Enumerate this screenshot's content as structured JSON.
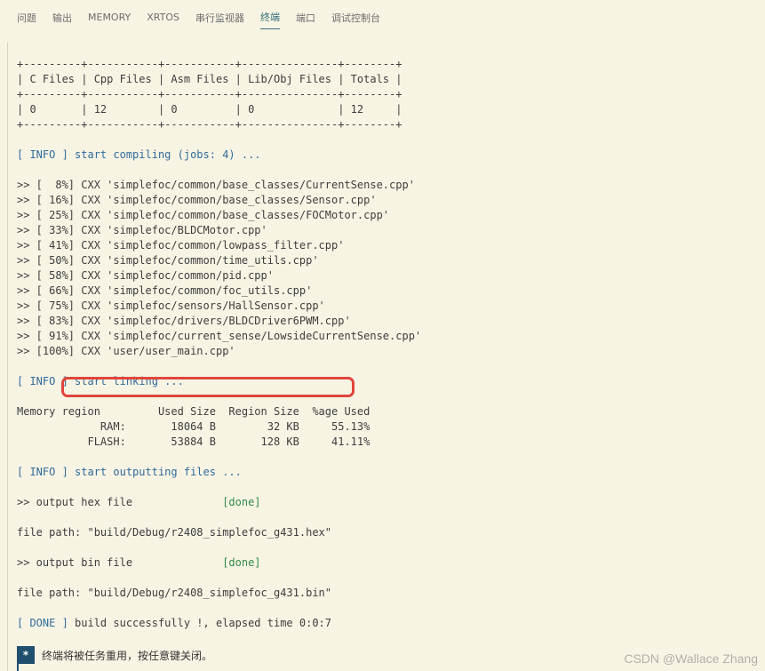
{
  "tabs": [
    {
      "label": "问题",
      "active": false
    },
    {
      "label": "输出",
      "active": false
    },
    {
      "label": "MEMORY",
      "active": false
    },
    {
      "label": "XRTOS",
      "active": false
    },
    {
      "label": "串行监视器",
      "active": false
    },
    {
      "label": "终端",
      "active": true
    },
    {
      "label": "端口",
      "active": false
    },
    {
      "label": "调试控制台",
      "active": false
    }
  ],
  "terminal": {
    "table": {
      "border": "+---------+-----------+-----------+---------------+--------+",
      "header": "| C Files | Cpp Files | Asm Files | Lib/Obj Files | Totals |",
      "row": "| 0       | 12        | 0         | 0             | 12     |"
    },
    "compile_info": "[ INFO ] start compiling (jobs: 4) ...",
    "compile_lines": [
      ">> [  8%] CXX 'simplefoc/common/base_classes/CurrentSense.cpp'",
      ">> [ 16%] CXX 'simplefoc/common/base_classes/Sensor.cpp'",
      ">> [ 25%] CXX 'simplefoc/common/base_classes/FOCMotor.cpp'",
      ">> [ 33%] CXX 'simplefoc/BLDCMotor.cpp'",
      ">> [ 41%] CXX 'simplefoc/common/lowpass_filter.cpp'",
      ">> [ 50%] CXX 'simplefoc/common/time_utils.cpp'",
      ">> [ 58%] CXX 'simplefoc/common/pid.cpp'",
      ">> [ 66%] CXX 'simplefoc/common/foc_utils.cpp'",
      ">> [ 75%] CXX 'simplefoc/sensors/HallSensor.cpp'",
      ">> [ 83%] CXX 'simplefoc/drivers/BLDCDriver6PWM.cpp'",
      ">> [ 91%] CXX 'simplefoc/current_sense/LowsideCurrentSense.cpp'",
      ">> [100%] CXX 'user/user_main.cpp'"
    ],
    "link_info": "[ INFO ] start linking ...",
    "memory_header": "Memory region         Used Size  Region Size  %age Used",
    "memory_ram": "             RAM:       18064 B        32 KB     55.13%",
    "memory_flash": "           FLASH:       53884 B       128 KB     41.11%",
    "output_info": "[ INFO ] start outputting files ...",
    "hex_prefix": ">> output hex file              ",
    "hex_status": "[done]",
    "hex_path": "file path: \"build/Debug/r2408_simplefoc_g431.hex\"",
    "bin_prefix": ">> output bin file              ",
    "bin_status": "[done]",
    "bin_path": "file path: \"build/Debug/r2408_simplefoc_g431.bin\"",
    "done_tag": "[ DONE ]",
    "done_rest": " build successfully !, elapsed time 0:0:7"
  },
  "notice": {
    "icon": "*",
    "text": "终端将被任务重用，按任意键关闭。"
  },
  "watermark": "CSDN @Wallace Zhang",
  "colors": {
    "info": "#2f6b9a",
    "done": "#2f8a4a",
    "highlight": "#e0463c",
    "accent": "#2f6c77"
  }
}
